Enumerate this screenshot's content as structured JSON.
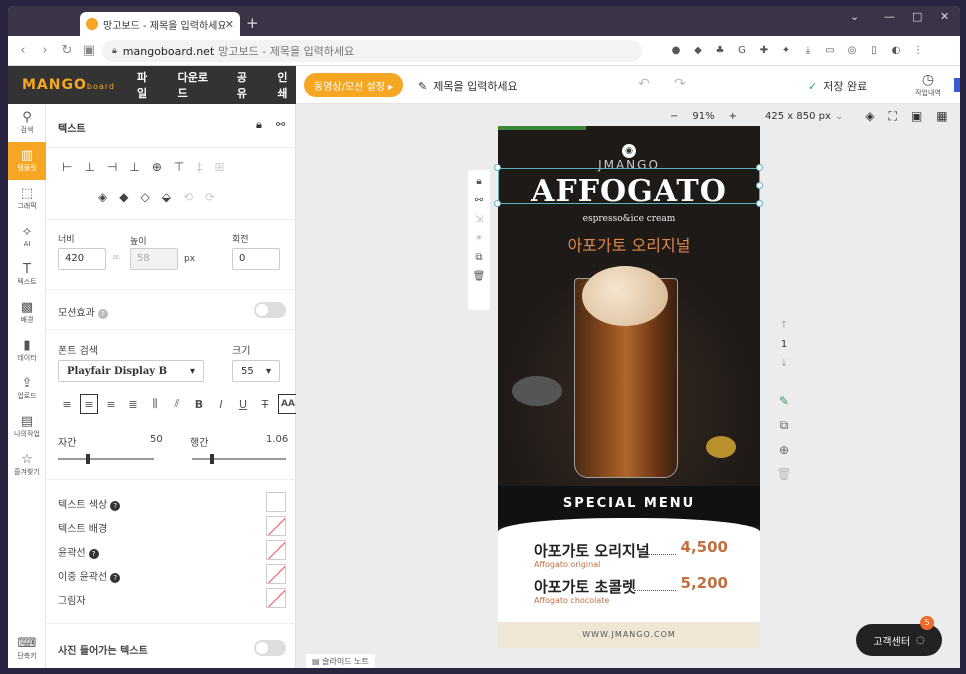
{
  "browser": {
    "tab_title": "망고보드 - 제목을 입력하세요",
    "tab_close": "✕",
    "new_tab": "+",
    "url_domain": "mangoboard.net",
    "url_rest": "망고보드 - 제목을 입력하세요",
    "controls": [
      "⌄",
      "—",
      "□",
      "✕"
    ]
  },
  "app": {
    "logo": "MANGO",
    "logo_small": "board",
    "menus": [
      "파일",
      "다운로드",
      "공유",
      "인쇄"
    ],
    "settings_button": "동영상/모션 설정 ▸",
    "title_placeholder": "제목을 입력하세요",
    "save_status": "저장 완료",
    "history_label": "작업내역"
  },
  "rail": [
    {
      "icon": "search-icon",
      "glyph": "⚲",
      "label": "검색"
    },
    {
      "icon": "template-icon",
      "glyph": "▥",
      "label": "템플릿",
      "active": true
    },
    {
      "icon": "graphic-icon",
      "glyph": "⬚",
      "label": "그래픽"
    },
    {
      "icon": "ai-icon",
      "glyph": "✧",
      "label": "AI"
    },
    {
      "icon": "text-icon",
      "glyph": "T",
      "label": "텍스트"
    },
    {
      "icon": "background-icon",
      "glyph": "▩",
      "label": "배경"
    },
    {
      "icon": "data-icon",
      "glyph": "▮",
      "label": "데이터"
    },
    {
      "icon": "upload-icon",
      "glyph": "⇪",
      "label": "업로드"
    },
    {
      "icon": "mywork-icon",
      "glyph": "▤",
      "label": "나의작업"
    },
    {
      "icon": "favorite-icon",
      "glyph": "☆",
      "label": "즐겨찾기"
    },
    {
      "icon": "shortcut-icon",
      "glyph": "⌨",
      "label": "단축키"
    }
  ],
  "panel": {
    "header": "텍스트",
    "width_label": "너비",
    "width_value": "420",
    "height_label": "높이",
    "height_value": "58",
    "unit": "px",
    "rotate_label": "회전",
    "rotate_value": "0",
    "motion_label": "모션효과",
    "font_search_label": "폰트 검색",
    "font_value": "Playfair Display B",
    "size_label": "크기",
    "size_value": "55",
    "letter_label": "자간",
    "letter_value": "50",
    "line_label": "행간",
    "line_value": "1.06",
    "text_color": "텍스트 색상",
    "text_bg": "텍스트 배경",
    "outline": "윤곽선",
    "double_outline": "이중 윤곽선",
    "shadow": "그림자",
    "photo_text": "사진 들어가는 텍스트"
  },
  "canvas": {
    "zoom": "91%",
    "zoom_minus": "−",
    "zoom_plus": "+",
    "size": "425 x 850 px",
    "page_number": "1",
    "slide_note": "슬라이드 노트",
    "customer_center": "고객센터",
    "badge": "5"
  },
  "design": {
    "brand": "JMANGO",
    "title": "AFFOGATO",
    "subtitle": "espresso&ice cream",
    "korean_title": "아포가토 오리지널",
    "special": "SPECIAL MENU",
    "items": [
      {
        "name": "아포가토 오리지널",
        "en": "Affogato original",
        "price": "4,500"
      },
      {
        "name": "아포가토 초콜렛",
        "en": "Affogato chocolate",
        "price": "5,200"
      }
    ],
    "footer": "WWW.JMANGO.COM"
  }
}
